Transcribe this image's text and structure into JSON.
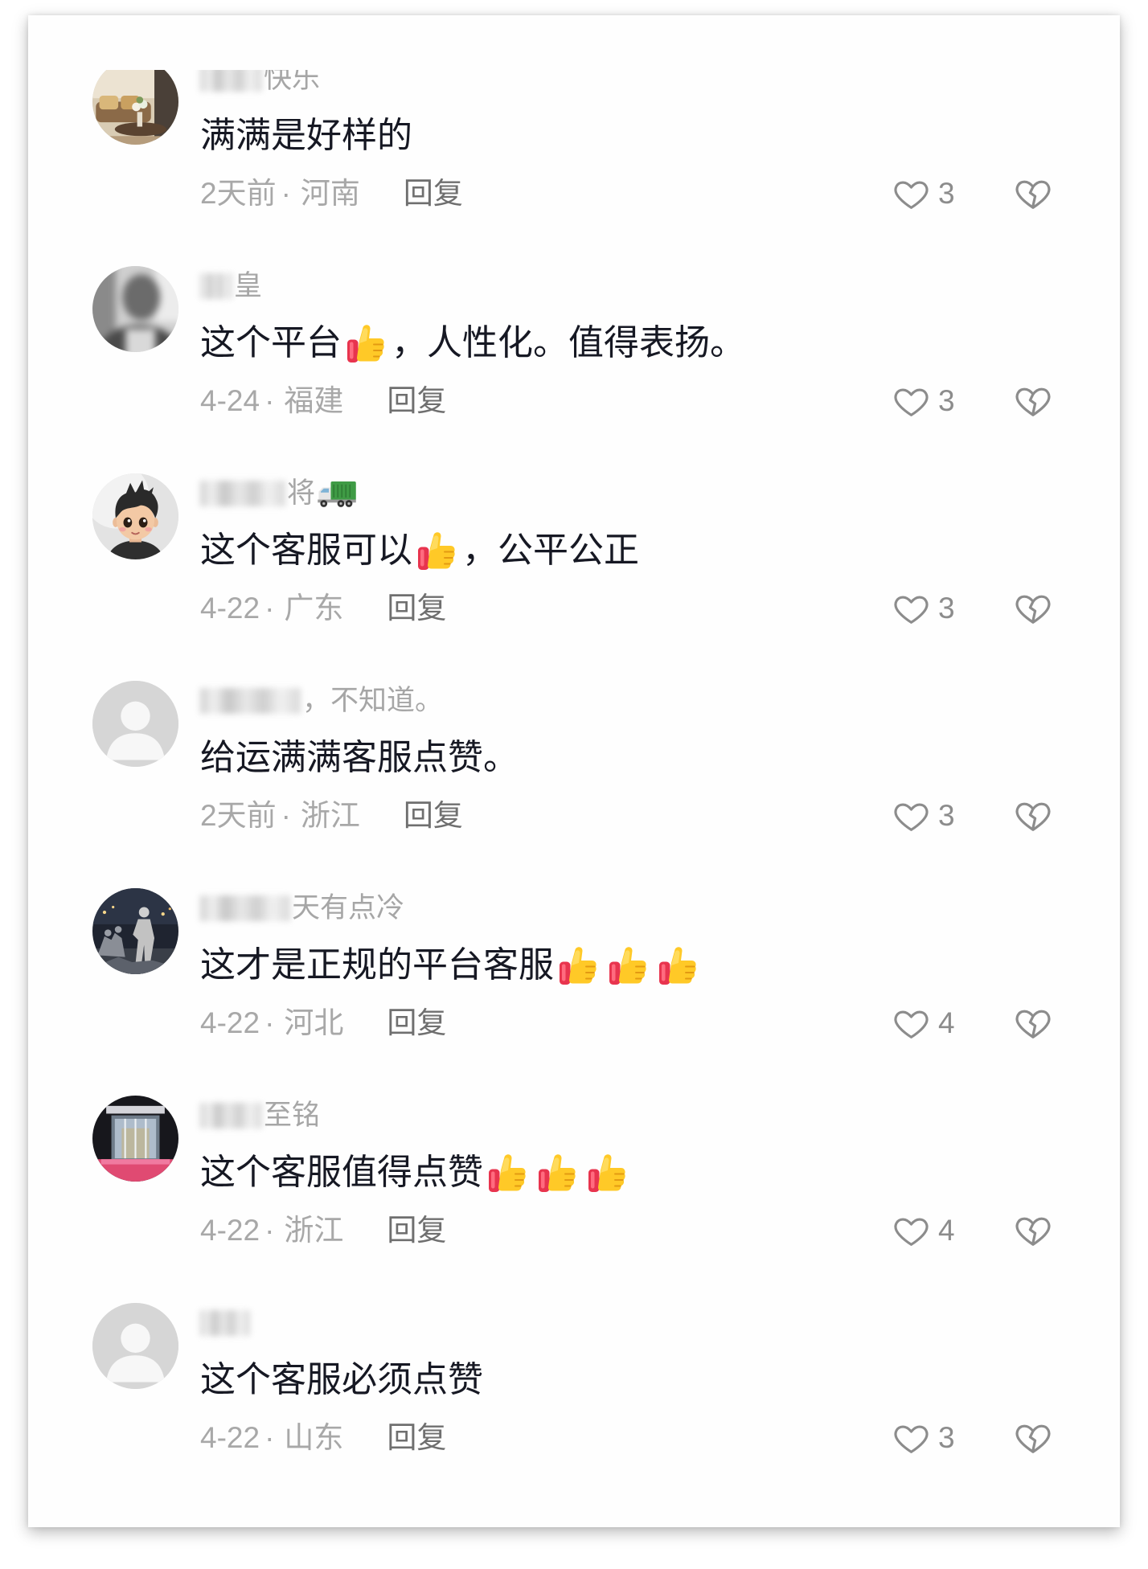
{
  "separator": "·",
  "reply_label": "回复",
  "colors": {
    "comment_text": "#161823",
    "username": "#a6a6a6",
    "meta": "#a8a8a8",
    "reply": "#6f6f6f",
    "icon": "#8c8c8c"
  },
  "comments": [
    {
      "user": {
        "name": [
          "快乐"
        ],
        "avatar": "living-room-photo"
      },
      "text": [
        "满满是好样的"
      ],
      "date": "2天前",
      "location": "河南",
      "likes": 3
    },
    {
      "user": {
        "name": [
          "皇"
        ],
        "avatar": "blurred-person-photo"
      },
      "text": [
        "这个平台",
        {
          "emoji": "thumbs-up"
        },
        "，人性化。值得表扬。"
      ],
      "date": "4-24",
      "location": "福建",
      "likes": 3
    },
    {
      "user": {
        "name": [
          "将",
          {
            "emoji": "truck"
          }
        ],
        "avatar": "cartoon-boy-avatar"
      },
      "text": [
        "这个客服可以",
        {
          "emoji": "thumbs-up"
        },
        "，公平公正"
      ],
      "date": "4-22",
      "location": "广东",
      "likes": 3
    },
    {
      "user": {
        "name": [
          "，不知道。"
        ],
        "avatar": "default-avatar"
      },
      "text": [
        "给运满满客服点赞。"
      ],
      "date": "2天前",
      "location": "浙江",
      "likes": 3
    },
    {
      "user": {
        "name": [
          "天有点冷"
        ],
        "avatar": "night-statue-photo"
      },
      "text": [
        "这才是正规的平台客服",
        {
          "emoji": "thumbs-up"
        },
        {
          "emoji": "thumbs-up"
        },
        {
          "emoji": "thumbs-up"
        }
      ],
      "date": "4-22",
      "location": "河北",
      "likes": 4
    },
    {
      "user": {
        "name": [
          "至铭"
        ],
        "avatar": "building-entrance-photo"
      },
      "text": [
        "这个客服值得点赞",
        {
          "emoji": "thumbs-up"
        },
        {
          "emoji": "thumbs-up"
        },
        {
          "emoji": "thumbs-up"
        }
      ],
      "date": "4-22",
      "location": "浙江",
      "likes": 4
    },
    {
      "user": {
        "name": [],
        "avatar": "default-avatar"
      },
      "text": [
        "这个客服必须点赞"
      ],
      "date": "4-22",
      "location": "山东",
      "likes": 3
    }
  ]
}
